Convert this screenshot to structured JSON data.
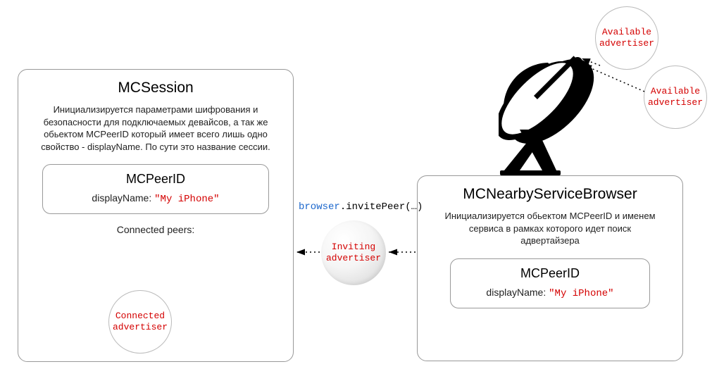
{
  "mcsession": {
    "title": "MCSession",
    "desc": "Инициализируется параметрами шифрования и безопасности для подключаемых девайсов, а так же обьектом MCPeerID который имеет всего лишь одно свойство - displayName. По сути это название сессии.",
    "peer": {
      "title": "MCPeerID",
      "displayNameLabel": "displayName:",
      "displayNameValue": "\"My iPhone\""
    },
    "connectedPeersLabel": "Connected peers:",
    "connectedCircle": "Connected\nadvertiser"
  },
  "browserBox": {
    "title": "MCNearbyServiceBrowser",
    "desc": "Инициализируется обьектом MCPeerID и именем сервиса в рамках которого идет поиск адвертайзера",
    "peer": {
      "title": "MCPeerID",
      "displayNameLabel": "displayName:",
      "displayNameValue": "\"My iPhone\""
    }
  },
  "code": {
    "browser": "browser",
    "invite": ".invitePeer(…)"
  },
  "inviting": "Inviting\nadvertiser",
  "avail1": "Available\nadvertiser",
  "avail2": "Available\nadvertiser"
}
